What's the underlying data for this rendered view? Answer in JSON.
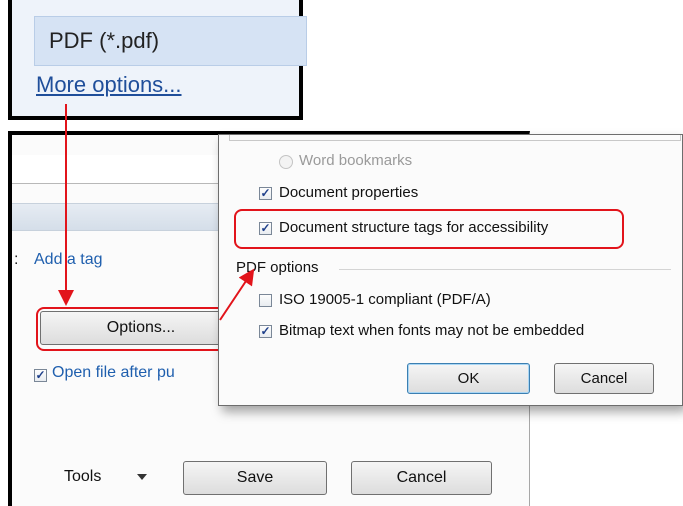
{
  "format_callout": {
    "selected_format": "PDF (*.pdf)",
    "more_options_link": "More options..."
  },
  "save_dialog": {
    "tags_label": ":",
    "add_tag_link": "Add a tag",
    "options_button": "Options...",
    "open_file_checkbox": {
      "checked": true,
      "label": "Open file after pu"
    },
    "tools_menu": "Tools",
    "save_button": "Save",
    "cancel_button": "Cancel"
  },
  "options_dialog": {
    "word_bookmarks_radio": {
      "label": "Word bookmarks",
      "enabled": false
    },
    "document_properties": {
      "label": "Document properties",
      "checked": true
    },
    "structure_tags": {
      "label": "Document structure tags for accessibility",
      "checked": true
    },
    "pdf_options_group": "PDF options",
    "iso_compliant": {
      "label": "ISO 19005-1 compliant (PDF/A)",
      "checked": false
    },
    "bitmap_text": {
      "label": "Bitmap text when fonts may not be embedded",
      "checked": true
    },
    "ok_button": "OK",
    "cancel_button": "Cancel"
  },
  "colors": {
    "highlight": "#e2141b",
    "link": "#1f5fae",
    "selection": "#d6e3f4"
  },
  "icons": [
    "checkbox-checked-icon",
    "checkbox-unchecked-icon",
    "radio-icon",
    "dropdown-caret-icon"
  ]
}
